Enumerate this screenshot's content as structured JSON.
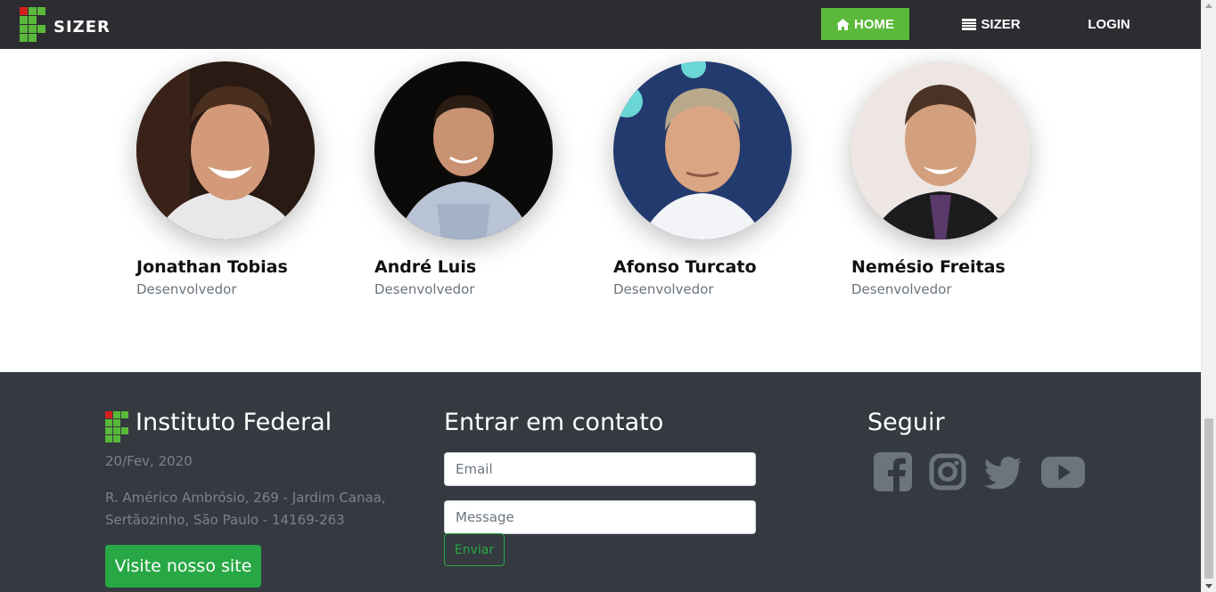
{
  "navbar": {
    "brand": "SIZER",
    "items": [
      {
        "label": "HOME",
        "icon": "home-icon",
        "active": true
      },
      {
        "label": "SIZER",
        "icon": "table-icon",
        "active": false
      },
      {
        "label": "LOGIN",
        "icon": "",
        "active": false
      }
    ],
    "active_color": "#5ab93a",
    "background": "#2b2d30"
  },
  "team": [
    {
      "name": "Jonathan Tobias",
      "role": "Desenvolvedor"
    },
    {
      "name": "André Luis",
      "role": "Desenvolvedor"
    },
    {
      "name": "Afonso Turcato",
      "role": "Desenvolvedor"
    },
    {
      "name": "Nemésio Freitas",
      "role": "Desenvolvedor"
    }
  ],
  "footer": {
    "institute": {
      "title": "Instituto Federal",
      "date": "20/Fev, 2020",
      "address_line1": "R. Américo Ambrósio, 269 - Jardim Canaa,",
      "address_line2": "Sertãozinho, São Paulo - 14169-263",
      "site_button": "Visite nosso site"
    },
    "contact": {
      "title": "Entrar em contato",
      "email_placeholder": "Email",
      "message_placeholder": "Message",
      "send_button": "Enviar"
    },
    "follow": {
      "title": "Seguir",
      "icons": [
        "facebook-icon",
        "instagram-icon",
        "twitter-icon",
        "youtube-icon"
      ]
    },
    "background": "#343a40",
    "button_color": "#28a745"
  }
}
